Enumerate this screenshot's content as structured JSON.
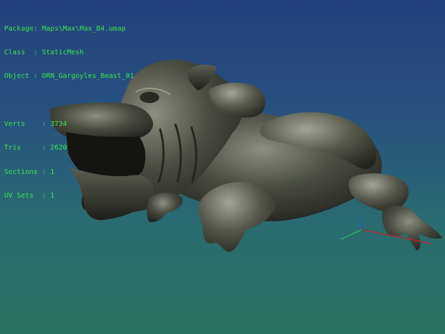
{
  "viewport_info": {
    "package_key": "Package",
    "package_value": "Maps\\Max\\Max_B4.umap",
    "class_key": "Class",
    "class_value": "StaticMesh",
    "object_key": "Object",
    "object_value": "ORN_Gargoyles_Beast_01",
    "verts_key": "Verts",
    "verts_value": "3734",
    "tris_key": "Tris",
    "tris_value": "2620",
    "sections_key": "Sections",
    "sections_value": "1",
    "uvsets_key": "UV Sets",
    "uvsets_value": "1"
  },
  "colors": {
    "hud_text": "#36e84a",
    "axis_x": "#d01c1c",
    "axis_y": "#22d04a",
    "axis_z": "#2a4fe0"
  },
  "mesh": {
    "icon": "gargoyle-beast-mesh"
  }
}
